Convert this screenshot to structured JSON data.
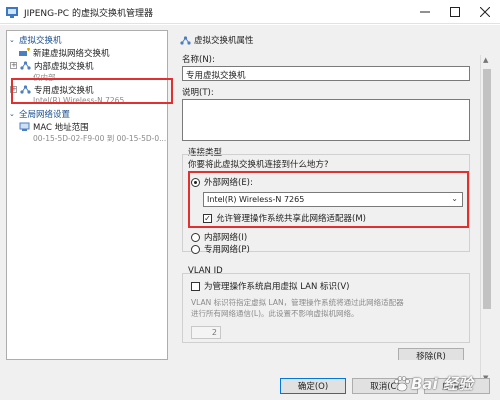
{
  "window": {
    "title": "JIPENG-PC 的虚拟交换机管理器",
    "app_icon": "switch-manager-icon",
    "controls": [
      "minimize-icon",
      "maximize-icon",
      "close-icon"
    ]
  },
  "tree": {
    "section_switches": "虚拟交换机",
    "items": [
      {
        "label": "新建虚拟网络交换机",
        "sub": "",
        "icon": "new-switch-icon"
      },
      {
        "label": "内部虚拟交换机",
        "sub": "仅内部",
        "icon": "switch-icon"
      },
      {
        "label": "专用虚拟交换机",
        "sub": "Intel(R) Wireless-N 7265",
        "icon": "switch-icon"
      }
    ],
    "section_global": "全局网络设置",
    "global_items": [
      {
        "label": "MAC 地址范围",
        "sub": "00-15-5D-02-F9-00 到 00-15-5D-0..."
      }
    ]
  },
  "props": {
    "header": "虚拟交换机属性",
    "name_label": "名称(N):",
    "name_value": "专用虚拟交换机",
    "notes_label": "说明(T):",
    "notes_value": "",
    "conn_group": "连接类型",
    "conn_question": "你要将此虚拟交换机连接到什么地方?",
    "external_label": "外部网络(E):",
    "adapter_selected": "Intel(R) Wireless-N 7265",
    "allow_mgmt_label": "允许管理操作系统共享此网络适配器(M)",
    "internal_label": "内部网络(I)",
    "private_label": "专用网络(P)",
    "selected_connection": "外部网络",
    "vlan_group": "VLAN ID",
    "vlan_check_label": "为管理操作系统启用虚拟 LAN 标识(V)",
    "vlan_desc_1": "VLAN 标识符指定虚拟 LAN，管理操作系统将通过此网络适配器",
    "vlan_desc_2": "进行所有网络通信(L)。此设置不影响虚拟机网络。",
    "vlan_value": "2",
    "remove_label": "移除(R)"
  },
  "buttons": {
    "ok": "确定(O)",
    "cancel": "取消(C)",
    "apply": "应用(A)"
  },
  "watermark": {
    "text": "Bai 经验"
  },
  "colors": {
    "highlight_red": "#e03030",
    "section_blue": "#1a4f8f",
    "default_button": "#0078d7"
  }
}
